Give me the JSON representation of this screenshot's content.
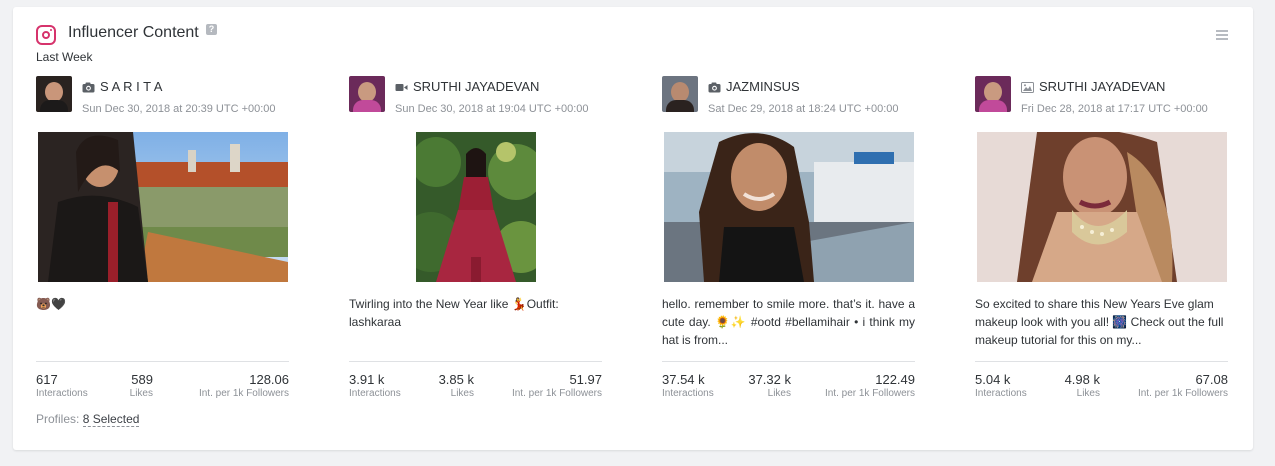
{
  "widget": {
    "title": "Influencer Content",
    "help": "?",
    "subtitle": "Last Week",
    "menu_icon": "hamburger-menu-icon"
  },
  "posts": [
    {
      "author": "S A R I T A",
      "post_type_icon": "camera-icon",
      "date": "Sun Dec 30, 2018 at 20:39 UTC +00:00",
      "caption": "🐻🖤",
      "interactions": "617",
      "likes": "589",
      "int_per_1k": "128.06"
    },
    {
      "author": "SRUTHI JAYADEVAN",
      "post_type_icon": "video-camera-icon",
      "date": "Sun Dec 30, 2018 at 19:04 UTC +00:00",
      "caption": "Twirling into the New Year like 💃Outfit: lashkaraa",
      "interactions": "3.91 k",
      "likes": "3.85 k",
      "int_per_1k": "51.97"
    },
    {
      "author": "JAZMINSUS",
      "post_type_icon": "camera-icon",
      "date": "Sat Dec 29, 2018 at 18:24 UTC +00:00",
      "caption": "hello. remember to smile more. that’s it. have a cute day. 🌻✨ #ootd #bellamihair • i think my hat is from...",
      "interactions": "37.54 k",
      "likes": "37.32 k",
      "int_per_1k": "122.49"
    },
    {
      "author": "SRUTHI JAYADEVAN",
      "post_type_icon": "image-icon",
      "date": "Fri Dec 28, 2018 at 17:17 UTC +00:00",
      "caption": "So excited to share this New Years Eve glam makeup look with you all! 🎆 Check out the full makeup tutorial for this on my...",
      "interactions": "5.04 k",
      "likes": "4.98 k",
      "int_per_1k": "67.08"
    }
  ],
  "labels": {
    "interactions": "Interactions",
    "likes": "Likes",
    "int_per_1k": "Int. per 1k Followers"
  },
  "footer": {
    "profiles_label": "Profiles:",
    "profiles_value": "8 Selected"
  },
  "colors": {
    "instagram": "#d6336c",
    "muted_text": "#8d9197",
    "text": "#2f3337"
  }
}
